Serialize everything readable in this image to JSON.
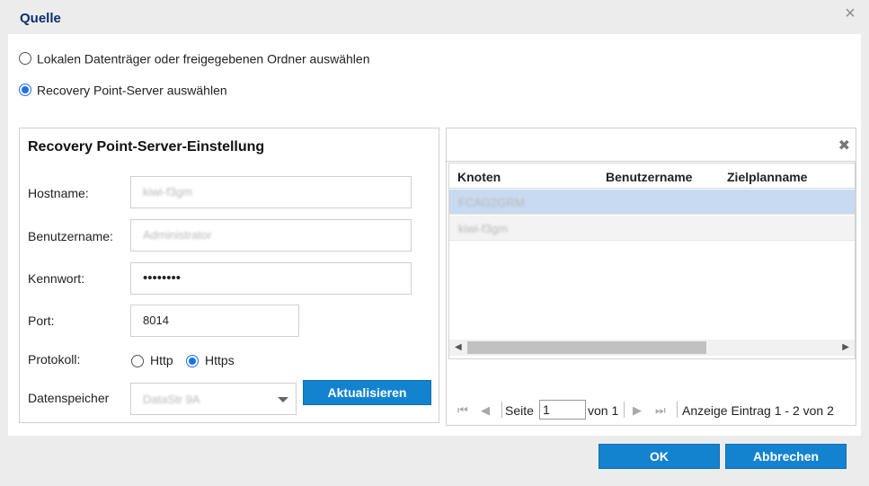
{
  "dialog": {
    "title": "Quelle"
  },
  "source_options": [
    {
      "label": "Lokalen Datenträger oder freigegebenen Ordner auswählen",
      "selected": false
    },
    {
      "label": "Recovery Point-Server auswählen",
      "selected": true
    }
  ],
  "rps_settings": {
    "title": "Recovery Point-Server-Einstellung",
    "hostname_label": "Hostname:",
    "hostname_value": "kiwi-f3gm",
    "username_label": "Benutzername:",
    "username_value": "Administrator",
    "password_label": "Kennwort:",
    "password_value": "••••••••",
    "port_label": "Port:",
    "port_value": "8014",
    "protocol_label": "Protokoll:",
    "protocol_options": [
      {
        "label": "Http",
        "selected": false
      },
      {
        "label": "Https",
        "selected": true
      }
    ],
    "datastore_label": "Datenspeicher",
    "datastore_value": "DataStr 9A",
    "refresh_button": "Aktualisieren"
  },
  "node_grid": {
    "columns": [
      "Knoten",
      "Benutzername",
      "Zielplanname"
    ],
    "rows": [
      {
        "node": "FCAG2GRM",
        "selected": true
      },
      {
        "node": "kiwi-f3gm",
        "selected": false
      }
    ],
    "pager": {
      "page_label": "Seite",
      "page_value": "1",
      "of_label": "von 1",
      "summary": "Anzeige Eintrag 1 - 2 von 2"
    }
  },
  "footer": {
    "ok_button": "OK",
    "cancel_button": "Abbrechen"
  },
  "colors": {
    "accent": "#1383d0",
    "title": "#0c2e6e",
    "selected_row": "#c7daf1"
  }
}
